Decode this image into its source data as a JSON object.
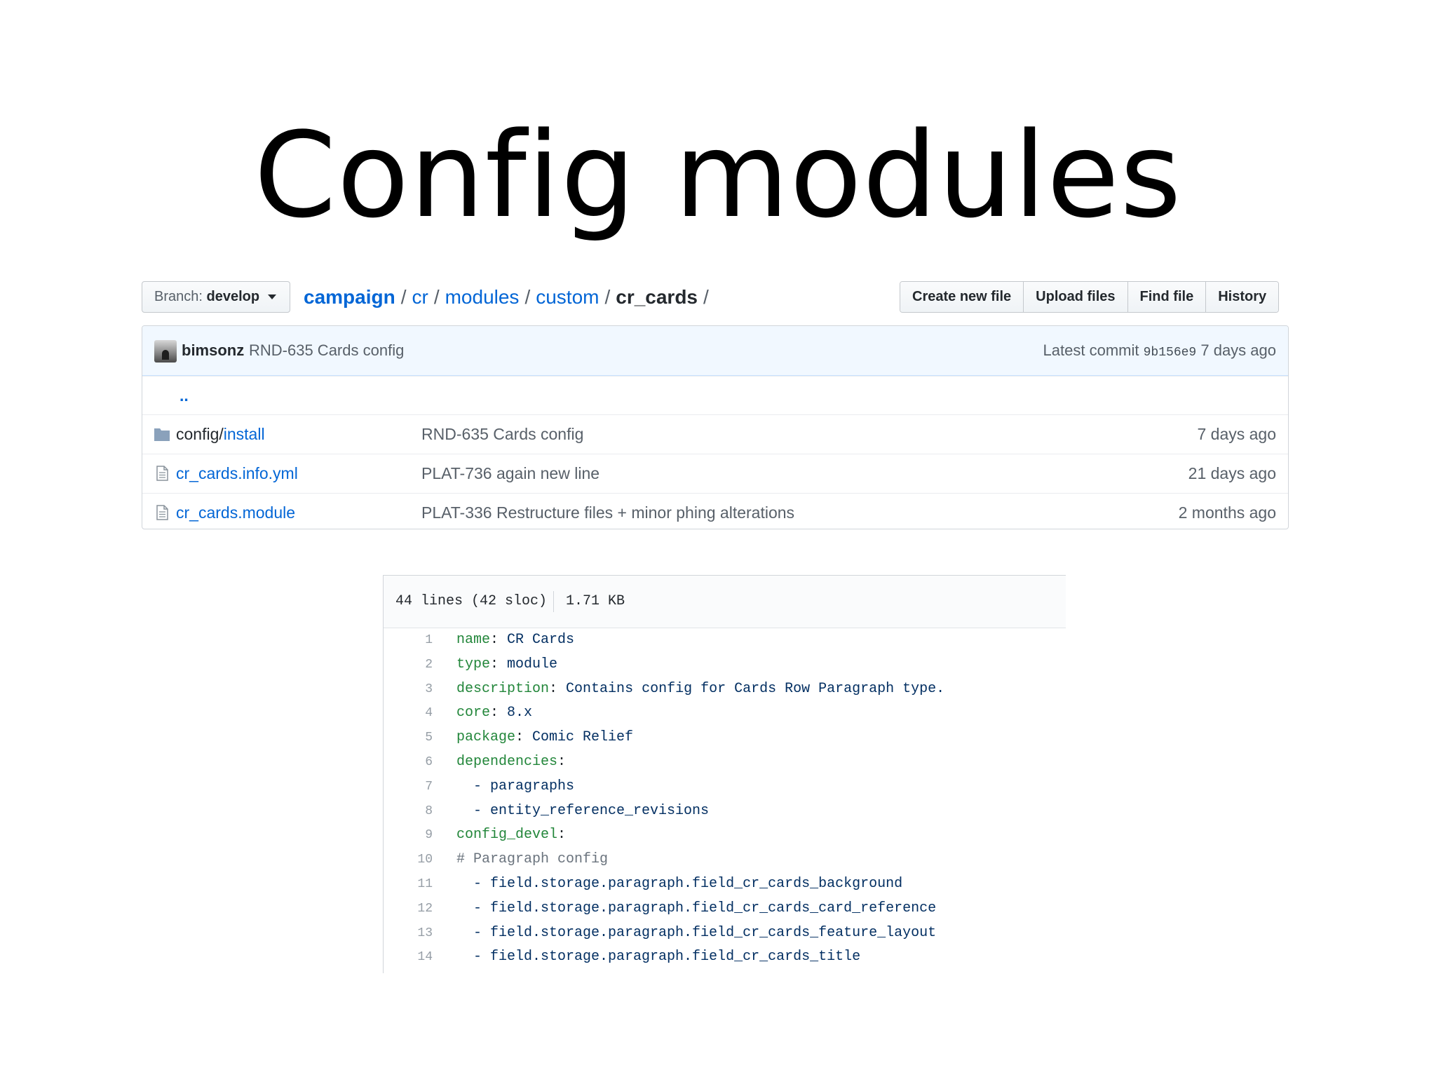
{
  "slide": {
    "title": "Config modules"
  },
  "repo_nav": {
    "branch_label": "Branch:",
    "branch_value": "develop",
    "breadcrumb": [
      "campaign",
      "cr",
      "modules",
      "custom"
    ],
    "breadcrumb_current": "cr_cards",
    "trailing_sep": "/",
    "buttons": {
      "create_new_file": "Create new file",
      "upload_files": "Upload files",
      "find_file": "Find file",
      "history": "History"
    }
  },
  "commit": {
    "author": "bimsonz",
    "message": "RND-635 Cards config",
    "latest_label": "Latest commit",
    "sha": "9b156e9",
    "age": "7 days ago"
  },
  "files": {
    "parent_link": "..",
    "rows": [
      {
        "type": "folder",
        "name_prefix": "config/",
        "name": "install",
        "message": "RND-635 Cards config",
        "age": "7 days ago"
      },
      {
        "type": "file",
        "name_prefix": "",
        "name": "cr_cards.info.yml",
        "message": "PLAT-736 again new line",
        "age": "21 days ago"
      },
      {
        "type": "file",
        "name_prefix": "",
        "name": "cr_cards.module",
        "message": "PLAT-336 Restructure files + minor phing alterations",
        "age": "2 months ago"
      }
    ]
  },
  "code_view": {
    "lines_info": "44 lines (42 sloc)",
    "size_info": "1.71 KB",
    "lines": [
      {
        "num": "1",
        "key": "name",
        "value": " CR Cards",
        "comment": ""
      },
      {
        "num": "2",
        "key": "type",
        "value": " module",
        "comment": ""
      },
      {
        "num": "3",
        "key": "description",
        "value": " Contains config for Cards Row Paragraph type.",
        "comment": ""
      },
      {
        "num": "4",
        "key": "core",
        "value": " 8.x",
        "comment": ""
      },
      {
        "num": "5",
        "key": "package",
        "value": " Comic Relief",
        "comment": ""
      },
      {
        "num": "6",
        "key": "dependencies",
        "value": "",
        "comment": ""
      },
      {
        "num": "7",
        "key": "",
        "value": "  - paragraphs",
        "comment": ""
      },
      {
        "num": "8",
        "key": "",
        "value": "  - entity_reference_revisions",
        "comment": ""
      },
      {
        "num": "9",
        "key": "config_devel",
        "value": "",
        "comment": ""
      },
      {
        "num": "10",
        "key": "",
        "value": "",
        "comment": "# Paragraph config"
      },
      {
        "num": "11",
        "key": "",
        "value": "  - field.storage.paragraph.field_cr_cards_background",
        "comment": ""
      },
      {
        "num": "12",
        "key": "",
        "value": "  - field.storage.paragraph.field_cr_cards_card_reference",
        "comment": ""
      },
      {
        "num": "13",
        "key": "",
        "value": "  - field.storage.paragraph.field_cr_cards_feature_layout",
        "comment": ""
      },
      {
        "num": "14",
        "key": "",
        "value": "  - field.storage.paragraph.field_cr_cards_title",
        "comment": ""
      }
    ]
  },
  "icons": {
    "folder": "folder-icon",
    "file": "file-icon"
  },
  "colors": {
    "link": "#0366d6",
    "yaml_key": "#22863a",
    "yaml_value": "#032f62",
    "commit_bar": "#f1f8ff"
  }
}
